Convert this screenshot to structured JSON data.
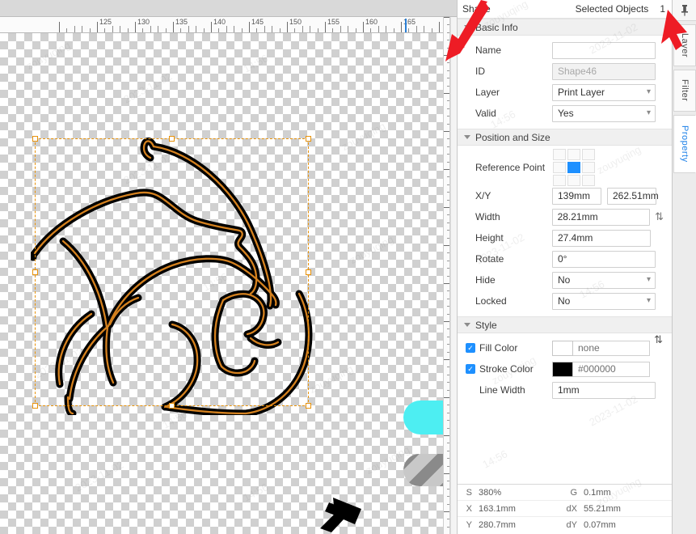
{
  "panel": {
    "title": "Shape",
    "selected_objects_label": "Selected Objects",
    "selected_objects_count": "1",
    "sections": {
      "basic_info": {
        "title": "Basic Info",
        "fields": {
          "name_label": "Name",
          "name_value": "",
          "id_label": "ID",
          "id_value": "Shape46",
          "layer_label": "Layer",
          "layer_value": "Print Layer",
          "valid_label": "Valid",
          "valid_value": "Yes"
        }
      },
      "position_and_size": {
        "title": "Position and Size",
        "fields": {
          "reference_point_label": "Reference Point",
          "xy_label": "X/Y",
          "x_value": "139mm",
          "y_value": "262.51mm",
          "width_label": "Width",
          "width_value": "28.21mm",
          "height_label": "Height",
          "height_value": "27.4mm",
          "rotate_label": "Rotate",
          "rotate_value": "0°",
          "hide_label": "Hide",
          "hide_value": "No",
          "locked_label": "Locked",
          "locked_value": "No"
        }
      },
      "style": {
        "title": "Style",
        "fields": {
          "fill_color_label": "Fill Color",
          "fill_color_value": "none",
          "fill_color_swatch": "#ffffff",
          "stroke_color_label": "Stroke Color",
          "stroke_color_value": "#000000",
          "stroke_color_swatch": "#000000",
          "line_width_label": "Line Width",
          "line_width_value": "1mm"
        }
      }
    }
  },
  "status_bar": {
    "rows": [
      {
        "key": "S",
        "value": "380%",
        "key2": "G",
        "value2": "0.1mm"
      },
      {
        "key": "X",
        "value": "163.1mm",
        "key2": "dX",
        "value2": "55.21mm"
      },
      {
        "key": "Y",
        "value": "280.7mm",
        "key2": "dY",
        "value2": "0.07mm"
      }
    ]
  },
  "tabs": {
    "pin_icon": "pin-icon",
    "items": [
      {
        "label": "Layer",
        "active": false
      },
      {
        "label": "Filter",
        "active": false
      },
      {
        "label": "Property",
        "active": true
      }
    ]
  },
  "ruler": {
    "unit": "mm",
    "labels": [
      "125",
      "130",
      "135",
      "140",
      "145",
      "150",
      "155",
      "160",
      "165"
    ],
    "cursor_position_label": "160"
  },
  "canvas": {
    "objects": [
      {
        "name": "wave-swirl-shape",
        "type": "path",
        "stroke": "#000000",
        "accent": "#D4811F"
      },
      {
        "name": "cyan-rounded-rect",
        "type": "rect",
        "fill": "#4DEEF2"
      },
      {
        "name": "striped-grey-rounded-rect",
        "type": "rect",
        "fill": "#8a8a8a"
      },
      {
        "name": "hammer-shape",
        "type": "path",
        "fill": "#000000"
      }
    ],
    "selection": {
      "visible": true,
      "color": "#e8920a"
    }
  },
  "watermarks": [
    "zouyuqing",
    "2023-11-02",
    "14:56",
    "zouyuqing",
    "2023-11-02",
    "14:56",
    "zouyuqing",
    "2023-11-02",
    "14:56",
    "zouyuqing",
    "2023-11-02",
    "14:56",
    "zouyuqing",
    "2023-11-02"
  ],
  "colors": {
    "accent_blue": "#1e90ff",
    "selection_orange": "#e8920a",
    "annotation_red": "#ee1c25",
    "active_tab_blue": "#1a7fe8"
  }
}
